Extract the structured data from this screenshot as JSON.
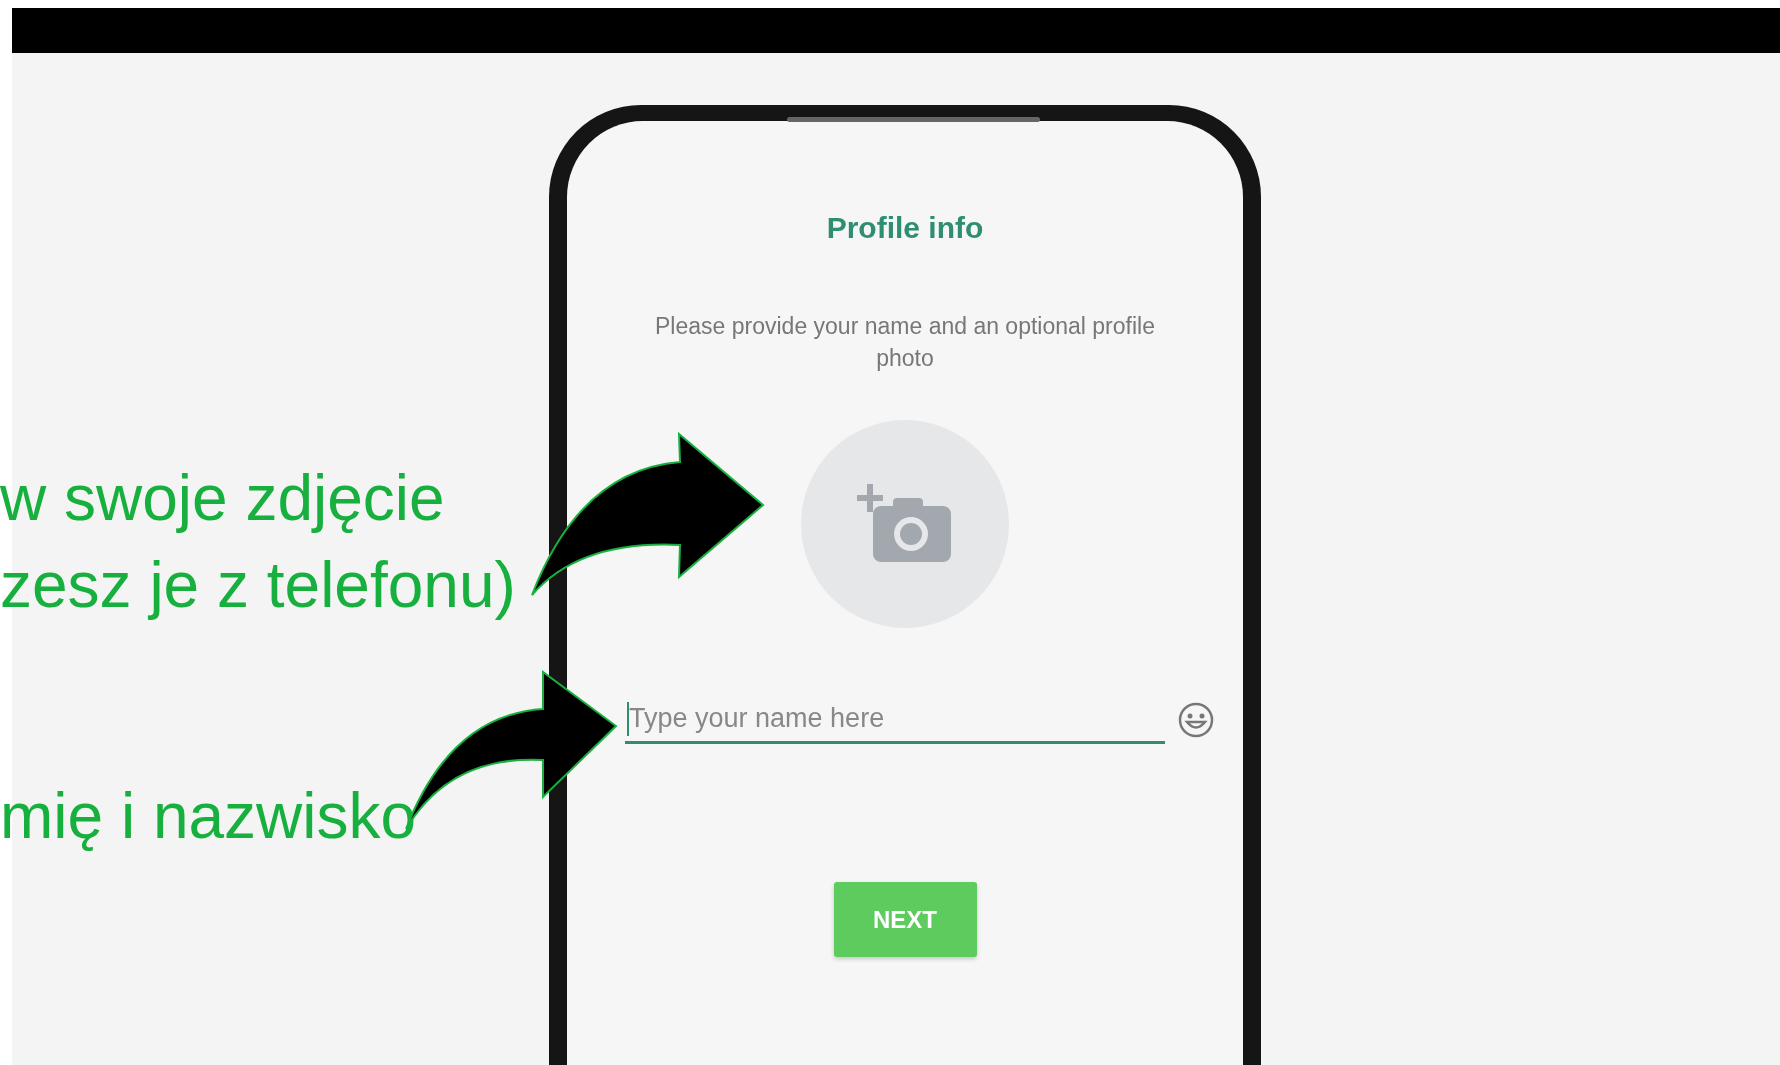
{
  "annotations": [
    {
      "text": "w swoje zdjęcie"
    },
    {
      "text": "zesz je z telefonu)"
    },
    {
      "text": "mię i nazwisko"
    }
  ],
  "screen": {
    "title": "Profile info",
    "description": "Please provide your name and an optional profile photo",
    "name_field": {
      "placeholder": "Type your name here",
      "focused": true
    },
    "next_button": "NEXT"
  }
}
